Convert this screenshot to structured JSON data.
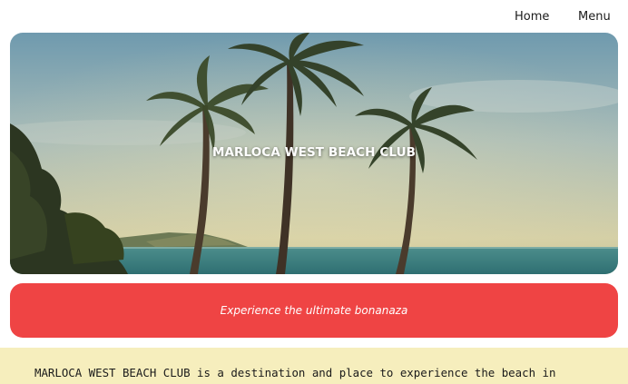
{
  "nav": {
    "home_label": "Home",
    "menu_label": "Menu"
  },
  "hero": {
    "title": "MARLOCA WEST BEACH CLUB",
    "image": "palm-trees-beach-photo"
  },
  "tagline": "Experience the ultimate bonanaza",
  "description": "MARLOCA WEST BEACH CLUB is a destination and place to experience the beach in",
  "colors": {
    "accent_red": "#ef4444",
    "description_bg": "#f6eebd",
    "text_dark": "#1a1a1a"
  }
}
